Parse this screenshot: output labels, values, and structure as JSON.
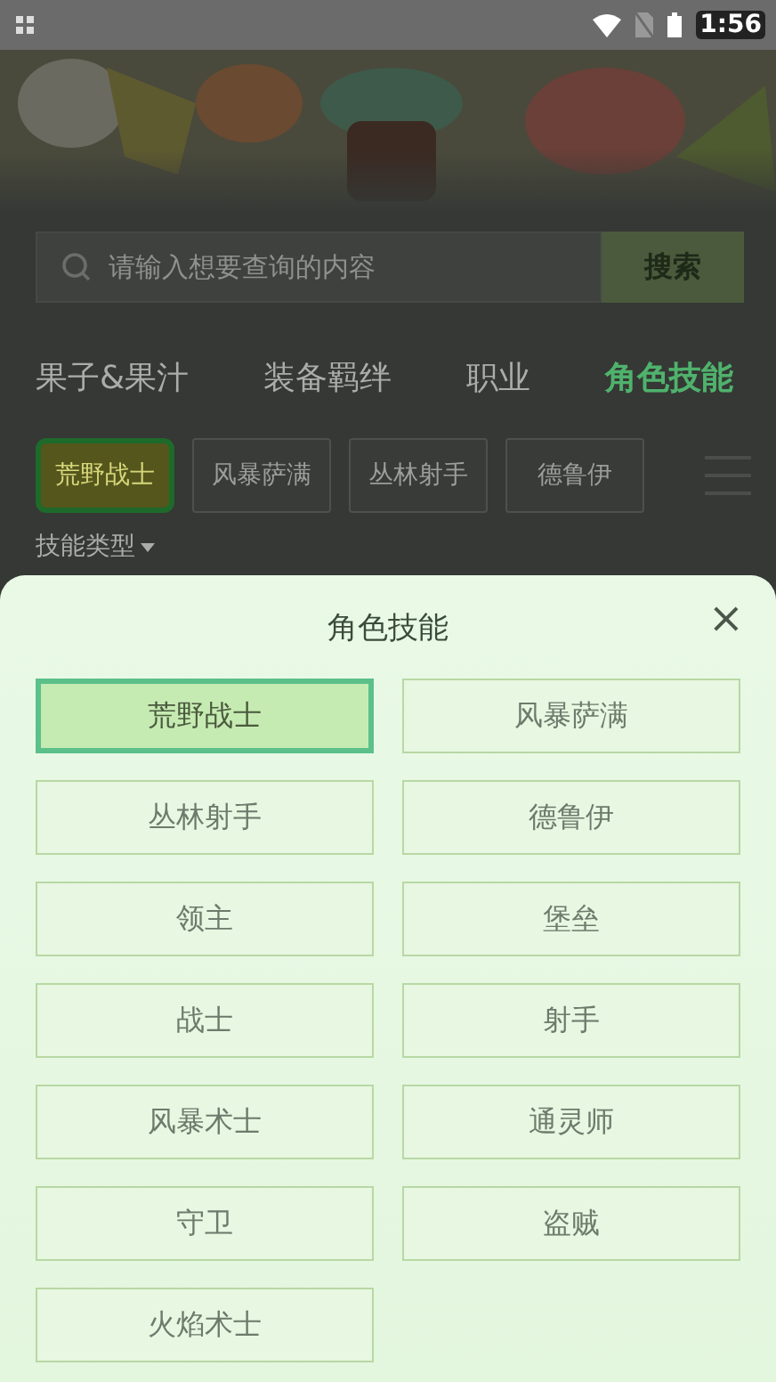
{
  "status_bar": {
    "time": "1:56"
  },
  "search": {
    "placeholder": "请输入想要查询的内容",
    "button": "搜索"
  },
  "tabs": [
    {
      "label": "果子&果汁",
      "selected": false
    },
    {
      "label": "装备羁绊",
      "selected": false
    },
    {
      "label": "职业",
      "selected": false
    },
    {
      "label": "角色技能",
      "selected": true
    }
  ],
  "chips": [
    {
      "label": "荒野战士",
      "selected": true
    },
    {
      "label": "风暴萨满",
      "selected": false
    },
    {
      "label": "丛林射手",
      "selected": false
    },
    {
      "label": "德鲁伊",
      "selected": false
    }
  ],
  "filter": {
    "label": "技能类型"
  },
  "sheet": {
    "title": "角色技能",
    "close": "×",
    "options": [
      {
        "label": "荒野战士",
        "selected": true
      },
      {
        "label": "风暴萨满",
        "selected": false
      },
      {
        "label": "丛林射手",
        "selected": false
      },
      {
        "label": "德鲁伊",
        "selected": false
      },
      {
        "label": "领主",
        "selected": false
      },
      {
        "label": "堡垒",
        "selected": false
      },
      {
        "label": "战士",
        "selected": false
      },
      {
        "label": "射手",
        "selected": false
      },
      {
        "label": "风暴术士",
        "selected": false
      },
      {
        "label": "通灵师",
        "selected": false
      },
      {
        "label": "守卫",
        "selected": false
      },
      {
        "label": "盗贼",
        "selected": false
      },
      {
        "label": "火焰术士",
        "selected": false
      }
    ]
  }
}
